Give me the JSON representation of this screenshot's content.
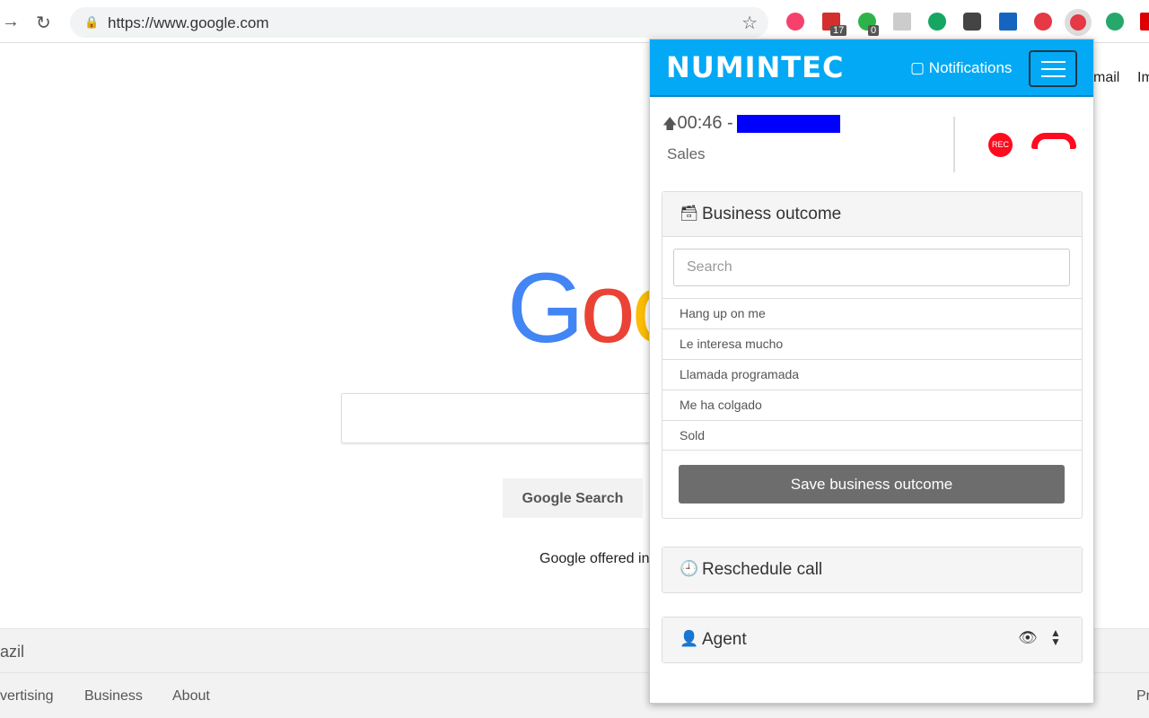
{
  "browser": {
    "url": "https://www.google.com",
    "badges": [
      "17",
      "0"
    ]
  },
  "google": {
    "logo": "Goo",
    "search_button": "Google Search",
    "offered": "Google offered in",
    "region": "azil",
    "footer_links": [
      "vertising",
      "Business",
      "About"
    ],
    "footer_right": "Pr",
    "gmail": "mail",
    "images": "Im"
  },
  "popup": {
    "brand": "NUMINTEC",
    "notifications": "Notifications",
    "call": {
      "time": "00:46 -",
      "queue": "Sales",
      "rec": "REC"
    },
    "business_outcome": {
      "title": "Business outcome",
      "search_placeholder": "Search",
      "options": [
        "Hang up on me",
        "Le interesa mucho",
        "Llamada programada",
        "Me ha colgado",
        "Sold"
      ],
      "save": "Save business outcome"
    },
    "reschedule": {
      "title": "Reschedule call"
    },
    "agent": {
      "title": "Agent"
    }
  },
  "colors": {
    "brand": "#03a9f4",
    "hangup": "#ff0a1e",
    "redaction": "#0000ff"
  }
}
